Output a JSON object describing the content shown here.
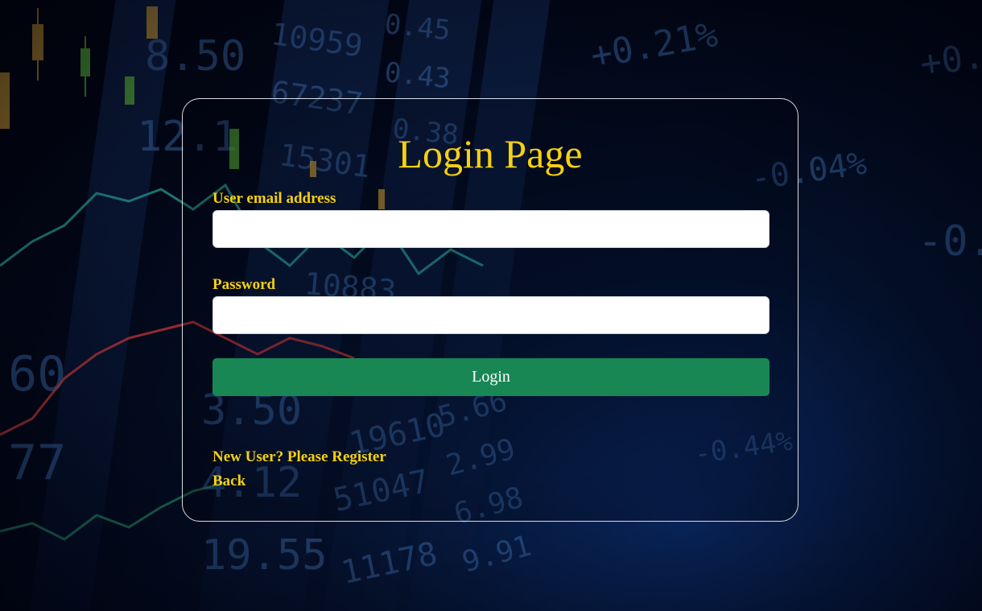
{
  "page": {
    "title": "Login Page"
  },
  "form": {
    "email_label": "User email address",
    "email_value": "",
    "password_label": "Password",
    "password_value": "",
    "login_label": "Login"
  },
  "links": {
    "register": "New User? Please Register",
    "back": "Back"
  },
  "colors": {
    "accent_text": "#f5d10f",
    "button": "#198754",
    "card_border": "#d9dce3"
  }
}
